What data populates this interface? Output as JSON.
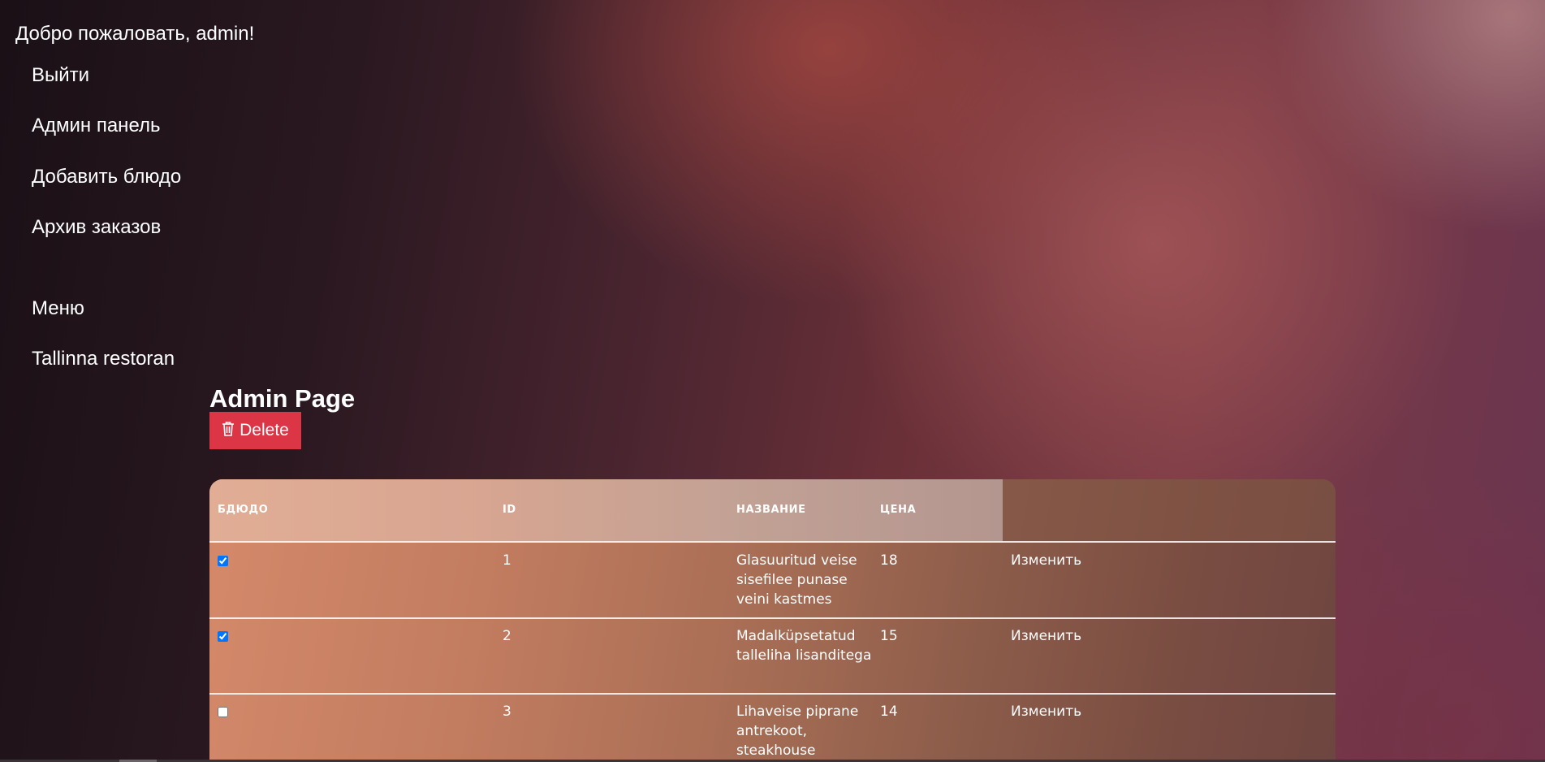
{
  "header": {
    "welcome": "Добро пожаловать, admin!"
  },
  "nav": {
    "logout": "Выйти",
    "admin_panel": "Админ панель",
    "add_dish": "Добавить блюдо",
    "orders_archive": "Архив заказов",
    "menu": "Меню",
    "restaurant": "Tallinna restoran"
  },
  "main": {
    "title": "Admin Page",
    "delete_label": "Delete",
    "delete_icon": "trash-icon",
    "delete_color": "#dc3545"
  },
  "table": {
    "columns": [
      "БДЮДО",
      "ID",
      "НАЗВАНИЕ",
      "ЦЕНА"
    ],
    "rows": [
      {
        "checked": true,
        "id": "1",
        "name": "Glasuuritud veise sisefilee punase veini kastmes",
        "price": "18",
        "action": "Изменить"
      },
      {
        "checked": true,
        "id": "2",
        "name": "Madalküpsetatud talleliha lisanditega",
        "price": "15",
        "action": "Изменить"
      },
      {
        "checked": false,
        "id": "3",
        "name": "Lihaveise piprane antrekoot, steakhouse",
        "price": "14",
        "action": "Изменить"
      }
    ]
  }
}
